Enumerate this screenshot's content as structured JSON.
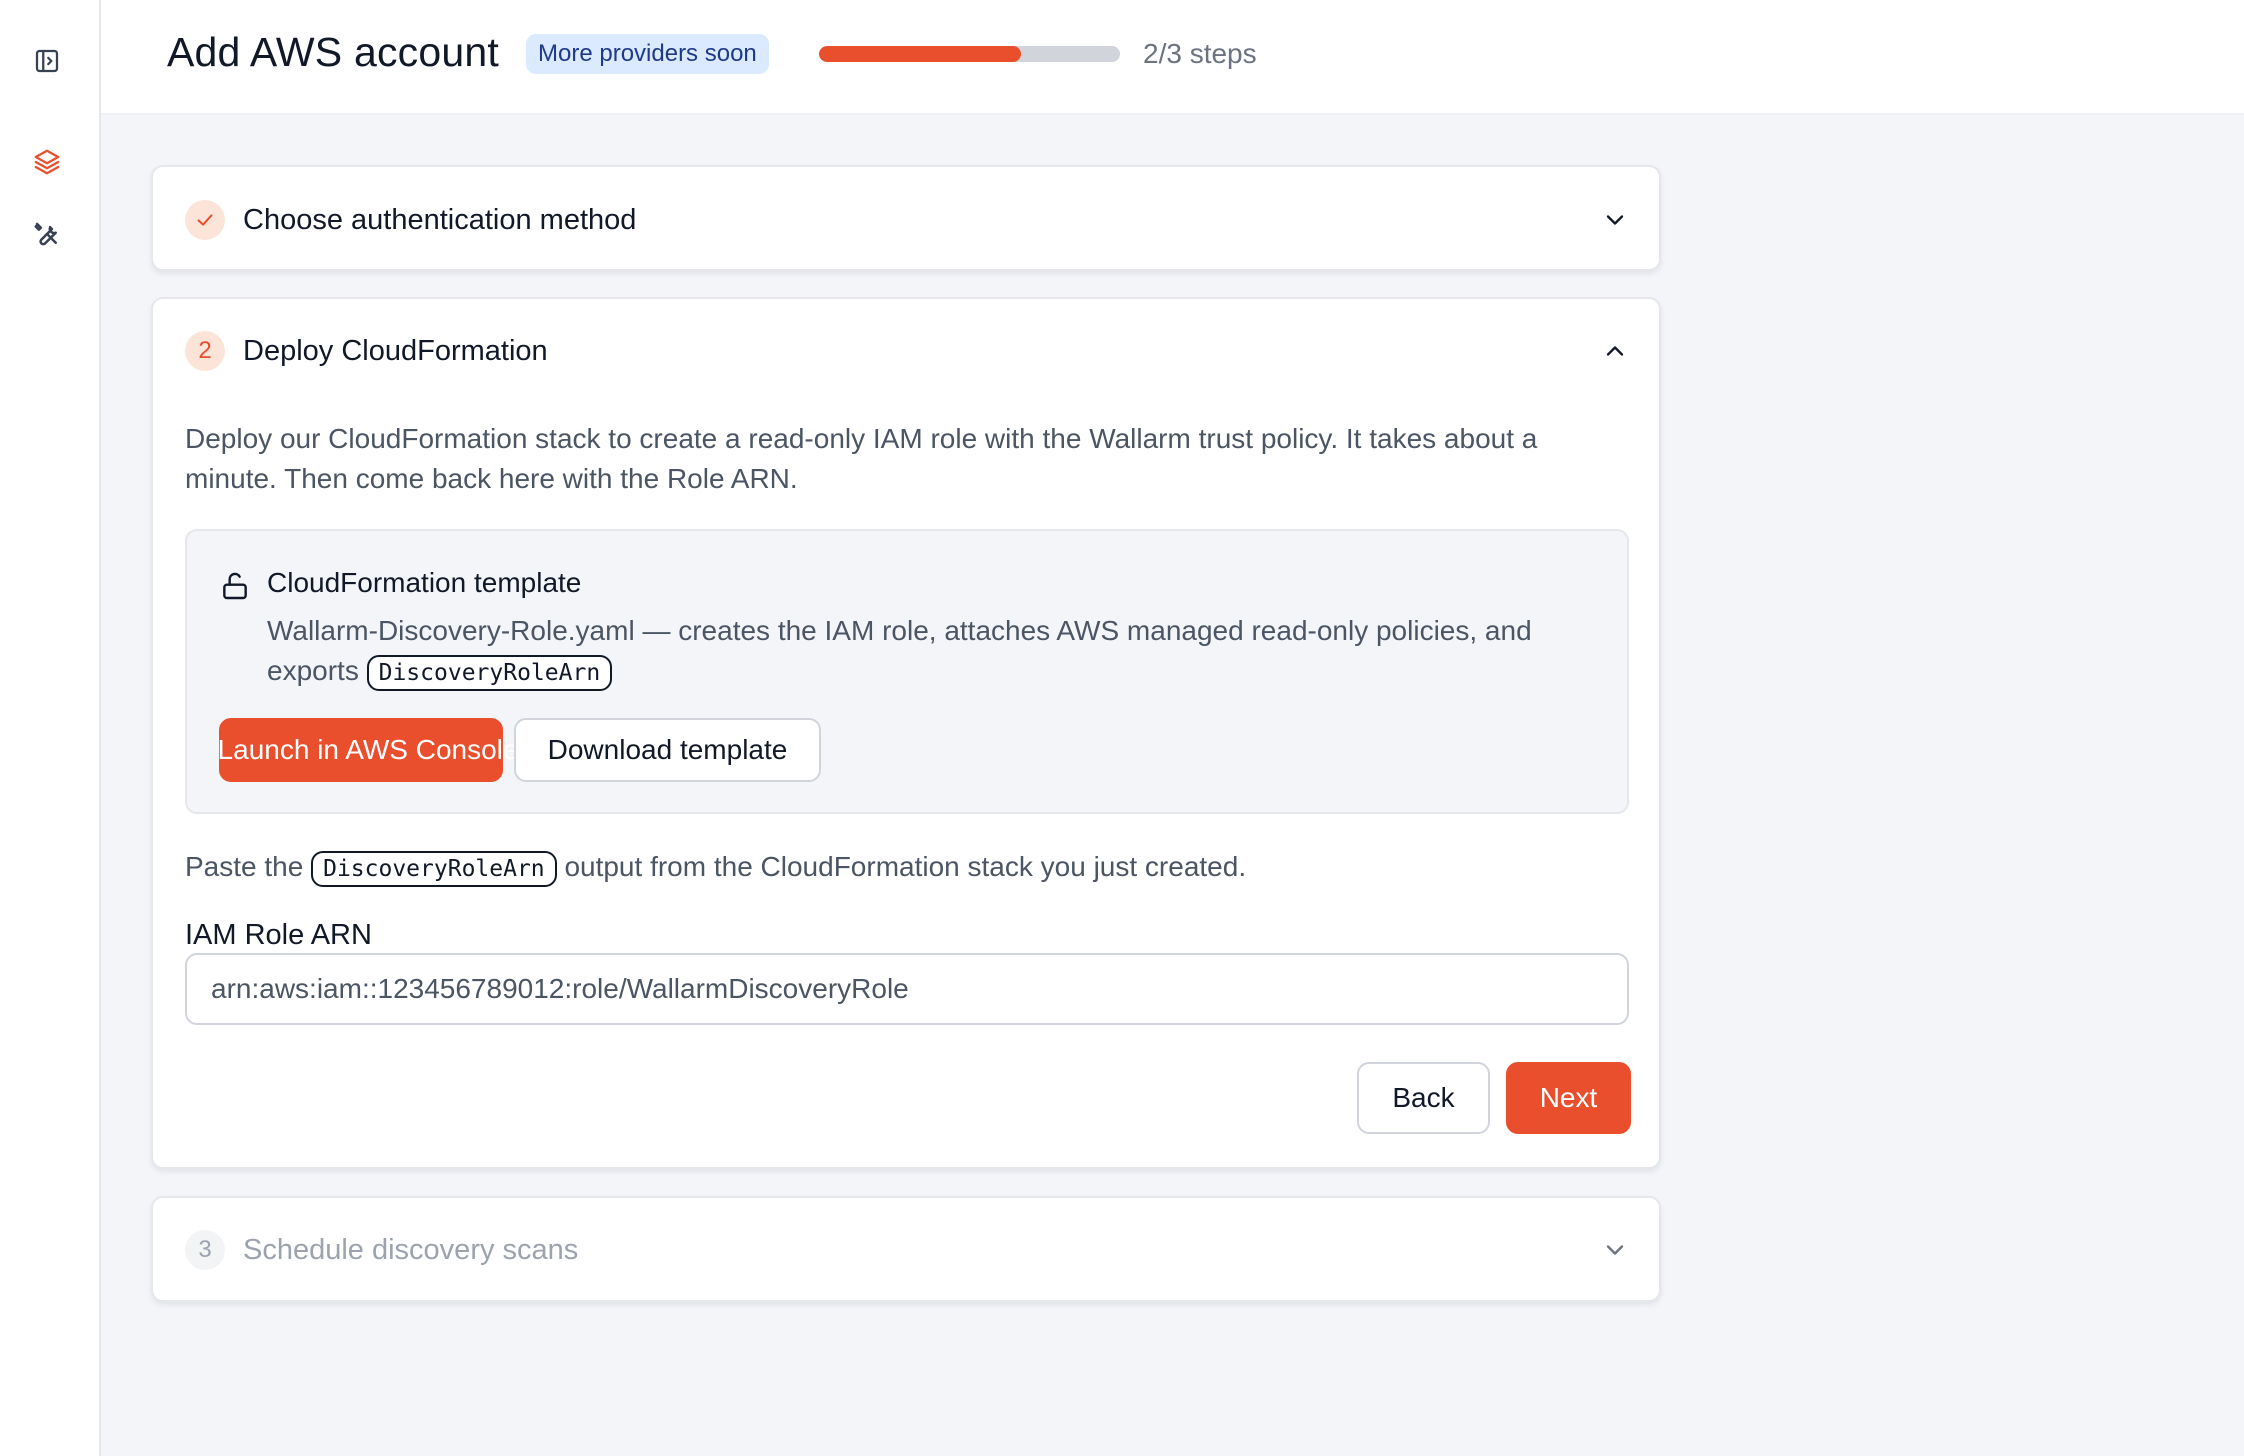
{
  "header": {
    "title": "Add AWS account",
    "badge": "More providers soon",
    "progress_percent": 67,
    "steps_label": "2/3 steps"
  },
  "sidebar": {
    "items": [
      {
        "name": "sidebar-toggle",
        "icon": "panel-toggle-icon"
      },
      {
        "name": "layers",
        "icon": "layers-icon",
        "active": true
      },
      {
        "name": "tools",
        "icon": "tools-icon"
      }
    ]
  },
  "steps": [
    {
      "number": "1",
      "title": "Choose authentication method",
      "state": "done"
    },
    {
      "number": "2",
      "title": "Deploy CloudFormation",
      "state": "active",
      "description": "Deploy our CloudFormation stack to create a read-only IAM role with the Wallarm trust policy. It takes about a minute. Then come back here with the Role ARN.",
      "template": {
        "title": "CloudFormation template",
        "desc_prefix": "Wallarm-Discovery-Role.yaml — creates the IAM role, attaches AWS managed read-only policies, and exports",
        "output_code": "DiscoveryRoleArn",
        "launch_label": "Launch in AWS Console",
        "download_label": "Download template"
      },
      "paste_prefix": "Paste the",
      "paste_code": "DiscoveryRoleArn",
      "paste_suffix": "output from the CloudFormation stack you just created.",
      "field_label": "IAM Role ARN",
      "field_placeholder": "arn:aws:iam::123456789012:role/WallarmDiscoveryRole",
      "back_label": "Back",
      "next_label": "Next"
    },
    {
      "number": "3",
      "title": "Schedule discovery scans",
      "state": "todo"
    }
  ],
  "colors": {
    "accent": "#ea4f2d",
    "badge_bg": "#dbeafe",
    "badge_text": "#1e3a8a",
    "background": "#f3f5f9"
  }
}
